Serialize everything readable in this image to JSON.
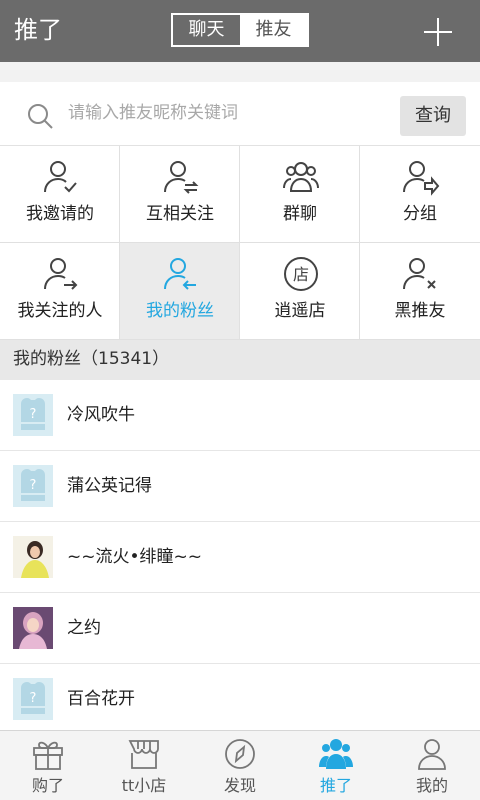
{
  "header": {
    "title": "推了",
    "segments": [
      "聊天",
      "推友"
    ],
    "active_segment": "推友",
    "add_icon": "plus-icon"
  },
  "search": {
    "placeholder": "请输入推友昵称关键词",
    "button_label": "查询",
    "icon": "search-icon"
  },
  "grid": {
    "items": [
      {
        "label": "我邀请的",
        "icon": "user-check-icon"
      },
      {
        "label": "互相关注",
        "icon": "user-exchange-icon"
      },
      {
        "label": "群聊",
        "icon": "group-icon"
      },
      {
        "label": "分组",
        "icon": "user-forward-icon"
      },
      {
        "label": "我关注的人",
        "icon": "user-arrow-right-icon"
      },
      {
        "label": "我的粉丝",
        "icon": "user-arrow-left-icon",
        "active": true
      },
      {
        "label": "逍遥店",
        "icon": "shop-badge-icon"
      },
      {
        "label": "黑推友",
        "icon": "user-block-icon"
      }
    ]
  },
  "section": {
    "title": "我的粉丝（15341）"
  },
  "fans": [
    {
      "name": "冷风吹牛",
      "avatar": "default-avatar"
    },
    {
      "name": "蒲公英记得",
      "avatar": "default-avatar"
    },
    {
      "name": "~~流火•绯瞳~~",
      "avatar": "photo-avatar"
    },
    {
      "name": "之约",
      "avatar": "photo-avatar"
    },
    {
      "name": "百合花开",
      "avatar": "default-avatar"
    }
  ],
  "tabbar": {
    "items": [
      {
        "label": "购了",
        "icon": "gift-icon"
      },
      {
        "label": "tt小店",
        "icon": "store-icon"
      },
      {
        "label": "发现",
        "icon": "compass-icon"
      },
      {
        "label": "推了",
        "icon": "people-icon",
        "active": true
      },
      {
        "label": "我的",
        "icon": "person-icon"
      }
    ]
  },
  "colors": {
    "header_bg": "#6b6b6b",
    "accent": "#23a7e0",
    "default_avatar_bg": "#d8ecf3"
  }
}
